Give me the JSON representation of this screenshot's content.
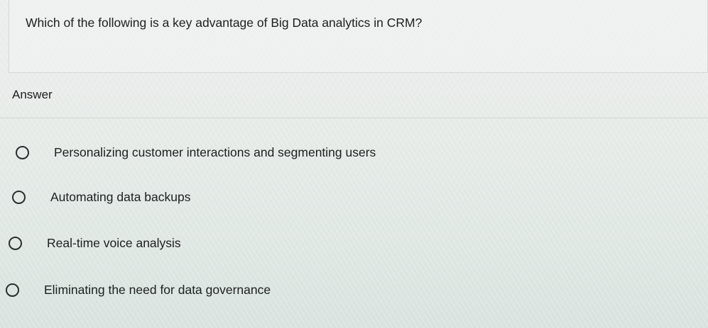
{
  "question": {
    "text": "Which of the following is a key advantage of Big Data analytics in CRM?"
  },
  "answer": {
    "label": "Answer",
    "options": [
      {
        "label": "Personalizing customer interactions and segmenting users",
        "selected": false
      },
      {
        "label": "Automating data backups",
        "selected": false
      },
      {
        "label": "Real-time voice analysis",
        "selected": false
      },
      {
        "label": "Eliminating the need for data governance",
        "selected": false
      }
    ]
  },
  "colors": {
    "text": "#1d1f21",
    "radio_border": "#2b2d2e",
    "background": "#e6ebe8"
  },
  "icons": {
    "radio": "radio-unchecked-icon"
  }
}
